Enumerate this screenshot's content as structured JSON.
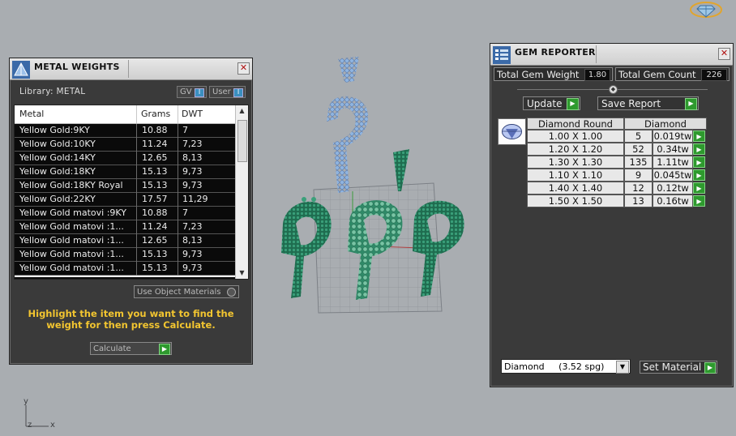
{
  "viewport": {
    "axis_y": "y",
    "axis_z": "z",
    "axis_x": "x"
  },
  "metal_panel": {
    "title": "METAL WEIGHTS",
    "close_glyph": "✕",
    "library_label": "Library: METAL",
    "gv_label": "GV",
    "gv_value": "I",
    "user_label": "User",
    "user_value": "I",
    "columns": [
      "Metal",
      "Grams",
      "DWT"
    ],
    "rows": [
      [
        "Yellow Gold:9KY",
        "10.88",
        "7"
      ],
      [
        "Yellow Gold:10KY",
        "11.24",
        "7,23"
      ],
      [
        "Yellow Gold:14KY",
        "12.65",
        "8,13"
      ],
      [
        "Yellow Gold:18KY",
        "15.13",
        "9,73"
      ],
      [
        "Yellow Gold:18KY Royal",
        "15.13",
        "9,73"
      ],
      [
        "Yellow Gold:22KY",
        "17.57",
        "11,29"
      ],
      [
        "Yellow Gold matovi :9KY",
        "10.88",
        "7"
      ],
      [
        "Yellow Gold matovi :1...",
        "11.24",
        "7,23"
      ],
      [
        "Yellow Gold matovi :1...",
        "12.65",
        "8,13"
      ],
      [
        "Yellow Gold matovi :1...",
        "15.13",
        "9,73"
      ],
      [
        "Yellow Gold matovi :1...",
        "15.13",
        "9,73"
      ]
    ],
    "use_object_materials": "Use Object Materials",
    "hint": "Highlight the item you want to find the weight for then press Calculate.",
    "calculate_label": "Calculate"
  },
  "gem_panel": {
    "title": "GEM REPORTER",
    "close_glyph": "✕",
    "total_weight_label": "Total Gem Weight",
    "total_weight_value": "1.80",
    "total_count_label": "Total Gem Count",
    "total_count_value": "226",
    "update_label": "Update",
    "save_report_label": "Save Report",
    "table_headers": [
      "Diamond Round",
      "Diamond"
    ],
    "rows": [
      [
        "1.00 X 1.00",
        "5",
        "0.019tw"
      ],
      [
        "1.20 X 1.20",
        "52",
        "0.34tw"
      ],
      [
        "1.30 X 1.30",
        "135",
        "1.11tw"
      ],
      [
        "1.10 X 1.10",
        "9",
        "0.045tw"
      ],
      [
        "1.40 X 1.40",
        "12",
        "0.12tw"
      ],
      [
        "1.50 X 1.50",
        "13",
        "0.16tw"
      ]
    ],
    "material_value": "Diamond     (3.52 spg)",
    "set_material_label": "Set Material"
  }
}
